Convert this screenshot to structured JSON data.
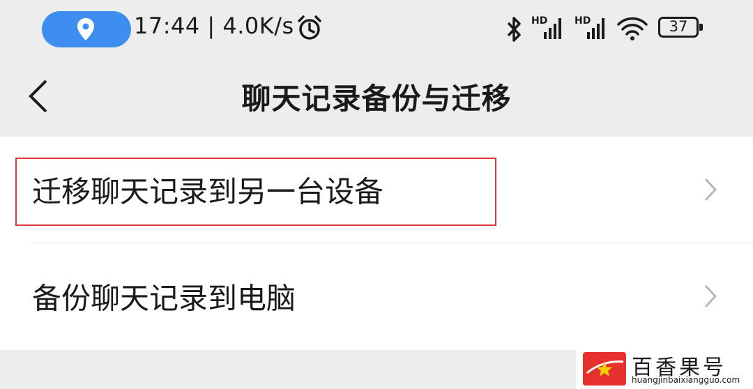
{
  "status_bar": {
    "time_speed": "17:44 | 4.0K/s",
    "signal_1_label": "HD",
    "signal_2_label": "HD",
    "battery": "37",
    "accent_color": "#3d8ef0",
    "icons": [
      "location-icon",
      "alarm-icon",
      "bluetooth-icon",
      "signal-icon",
      "signal-icon",
      "wifi-icon",
      "battery-icon"
    ]
  },
  "nav": {
    "back_icon": "chevron-left-icon",
    "title": "聊天记录备份与迁移"
  },
  "menu": {
    "items": [
      {
        "label": "迁移聊天记录到另一台设备",
        "icon": "chevron-right-icon"
      },
      {
        "label": "备份聊天记录到电脑",
        "icon": "chevron-right-icon"
      }
    ]
  },
  "highlight_color": "#d93a3a",
  "watermark": {
    "name": "百香果号",
    "url": "huangjinbaixiangguo.com"
  }
}
